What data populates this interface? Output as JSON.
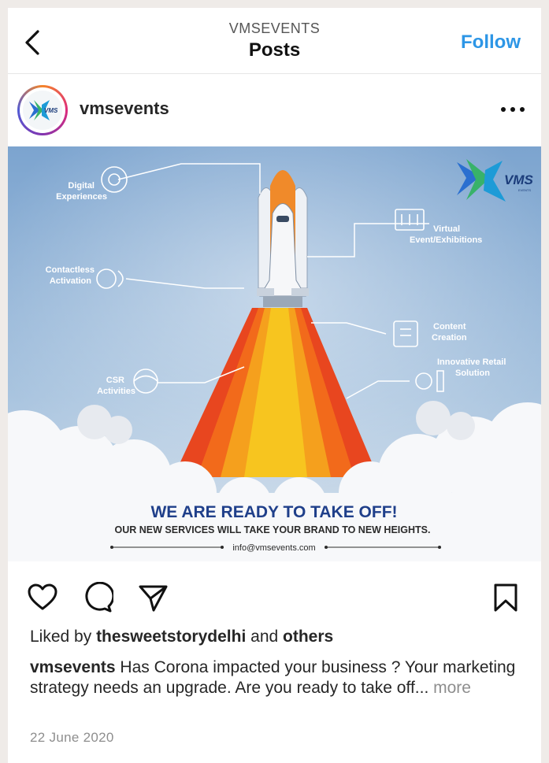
{
  "header": {
    "account": "VMSEVENTS",
    "title": "Posts",
    "follow_label": "Follow",
    "back_icon": "chevron-left-icon"
  },
  "post": {
    "username": "vmsevents",
    "avatar_logo_text": "VMS",
    "more_icon": "more-horizontal-icon",
    "image": {
      "logo_text": "VMS",
      "logo_subtext": "EVENTS",
      "labels": {
        "digital_line1": "Digital",
        "digital_line2": "Experiences",
        "virtual_line1": "Virtual",
        "virtual_line2": "Event/Exhibitions",
        "contactless_line1": "Contactless",
        "contactless_line2": "Activation",
        "content_line1": "Content",
        "content_line2": "Creation",
        "retail_line1": "Innovative Retail",
        "retail_line2": "Solution",
        "csr_line1": "CSR",
        "csr_line2": "Activities"
      },
      "headline": "WE ARE READY TO TAKE OFF!",
      "subline": "OUR NEW SERVICES WILL TAKE YOUR BRAND TO NEW HEIGHTS.",
      "email": "info@vmsevents.com"
    },
    "actions": {
      "like_icon": "heart-icon",
      "comment_icon": "comment-icon",
      "share_icon": "send-icon",
      "save_icon": "bookmark-icon"
    },
    "likes": {
      "prefix": "Liked by",
      "user": "thesweetstorydelhi",
      "joiner": "and",
      "others": "others"
    },
    "caption": {
      "user": "vmsevents",
      "text": "Has Corona impacted your business ? Your marketing strategy needs an upgrade. Are you ready to take off...",
      "more": "more"
    },
    "date": "22 June 2020"
  },
  "colors": {
    "follow_blue": "#2d96e6",
    "sky": "#7ea6d0",
    "headline_blue": "#1f3f8a",
    "flame_orange": "#f26a1b",
    "flame_yellow": "#f7c51f"
  }
}
